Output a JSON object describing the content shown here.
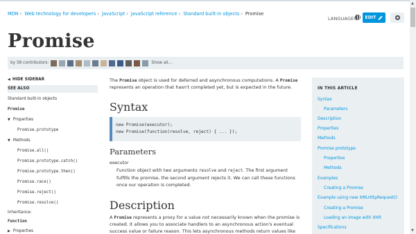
{
  "breadcrumb": {
    "items": [
      "MDN",
      "Web technology for developers",
      "JavaScript",
      "JavaScript reference",
      "Standard built-in objects"
    ],
    "separator": "›",
    "current": "Promise"
  },
  "header": {
    "languages_label": "LANGUAGES",
    "edit_label": "EDIT"
  },
  "page": {
    "title": "Promise"
  },
  "contributors": {
    "label": "by 58 contributors:",
    "show_all": "Show all…"
  },
  "sidebar": {
    "hide_label": "HIDE SIDEBAR",
    "see_also": "SEE ALSO",
    "standard_objects": "Standard built-in objects",
    "promise": "Promise",
    "properties_label": "Properties",
    "prototype": "Promise.prototype",
    "methods_label": "Methods",
    "methods": [
      "Promise.all()",
      "Promise.prototype.catch()",
      "Promise.prototype.then()",
      "Promise.race()",
      "Promise.reject()",
      "Promise.resolve()"
    ],
    "inheritance": "Inheritance:",
    "function": "Function",
    "properties2": "Properties"
  },
  "content": {
    "intro_pre": "The ",
    "intro_code1": "Promise",
    "intro_mid": " object is used for deferred and asynchronous computations. A ",
    "intro_code2": "Promise",
    "intro_post": " represents an operation that hasn't completed yet, but is expected in the future.",
    "syntax_heading": "Syntax",
    "syntax_line1": "new Promise(executor);",
    "syntax_line2": "new Promise(function(resolve, reject) { ... });",
    "parameters_heading": "Parameters",
    "param_name": "executor",
    "param_desc_1": "Function object with two arguments ",
    "param_code1": "resolve",
    "param_desc_2": " and ",
    "param_code2": "reject",
    "param_desc_3": ". The first argument fulfills the promise, the second argument rejects it. We can call these functions once our operation is completed.",
    "description_heading": "Description",
    "desc_pre": "A ",
    "desc_code": "Promise",
    "desc_post": " represents a proxy for a value not necessarily known when the promise is created. It allows you to associate handlers to an asynchronous action's eventual success value or failure reason. This lets asynchronous methods return values like synchronous"
  },
  "toc": {
    "heading": "IN THIS ARTICLE",
    "items": [
      "Syntax",
      "Parameters",
      "Description",
      "Properties",
      "Methods",
      "Promise prototype",
      "Properties",
      "Methods",
      "Examples",
      "Creating a Promise",
      "Example using new XMLHttpRequest()",
      "Creating a Promise",
      "Loading an image with XHR",
      "Specifications"
    ]
  },
  "colors": {
    "link": "#0095dd",
    "panel": "#eaeff2",
    "code_border": "#558abb"
  }
}
